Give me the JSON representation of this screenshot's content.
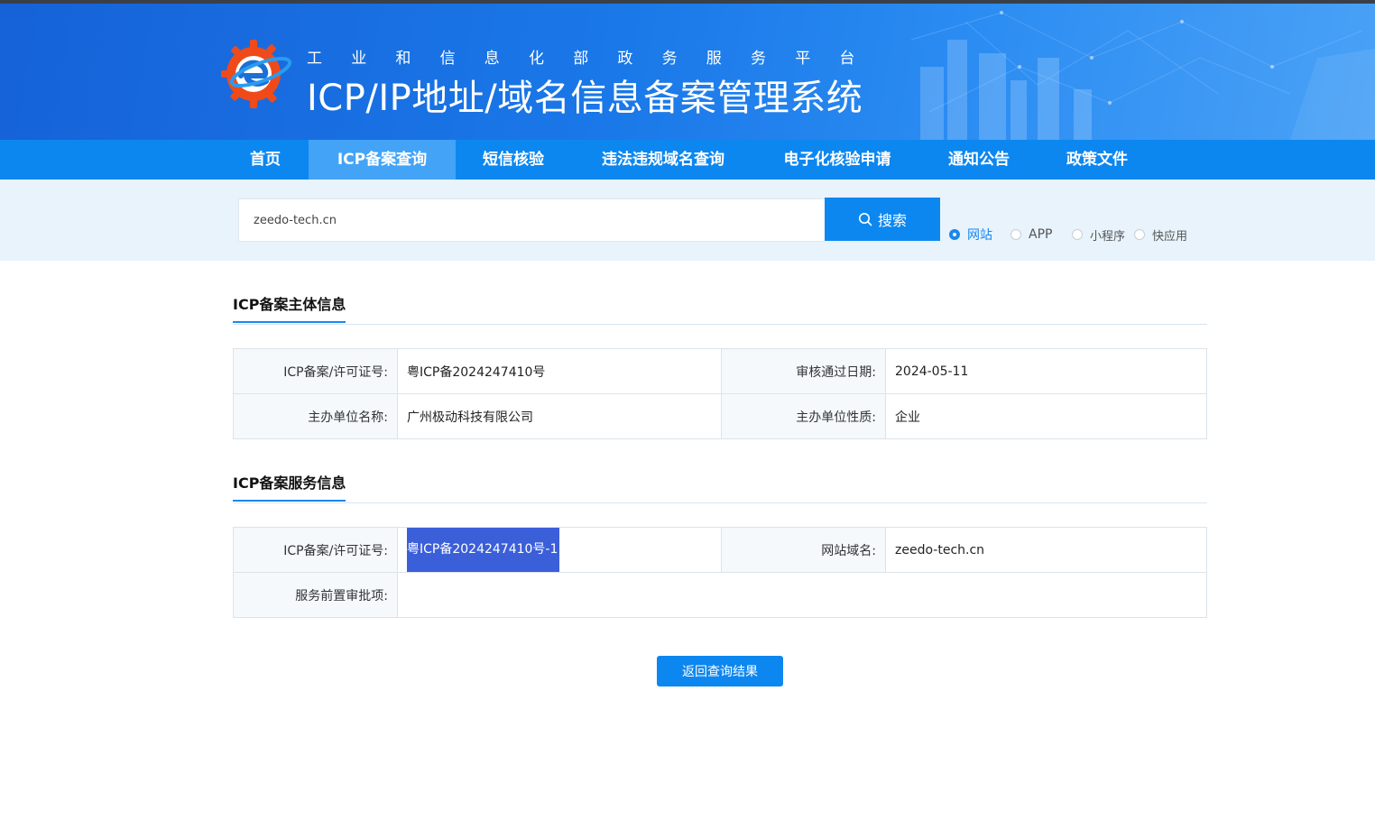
{
  "header": {
    "subtitle": "工业和信息化部政务服务平台",
    "title": "ICP/IP地址/域名信息备案管理系统"
  },
  "nav": {
    "items": [
      {
        "label": "首页"
      },
      {
        "label": "ICP备案查询"
      },
      {
        "label": "短信核验"
      },
      {
        "label": "违法违规域名查询"
      },
      {
        "label": "电子化核验申请"
      },
      {
        "label": "通知公告"
      },
      {
        "label": "政策文件"
      }
    ],
    "active": "ICP备案查询"
  },
  "search": {
    "value": "zeedo-tech.cn",
    "button_label": "搜索",
    "options": [
      {
        "label": "网站",
        "checked": true
      },
      {
        "label": "APP",
        "checked": false
      },
      {
        "label": "小程序",
        "checked": false
      },
      {
        "label": "快应用",
        "checked": false
      }
    ]
  },
  "subject": {
    "section_title": "ICP备案主体信息",
    "license_label": "ICP备案/许可证号:",
    "license_value": "粤ICP备2024247410号",
    "approval_date_label": "审核通过日期:",
    "approval_date_value": "2024-05-11",
    "org_name_label": "主办单位名称:",
    "org_name_value": "广州极动科技有限公司",
    "org_type_label": "主办单位性质:",
    "org_type_value": "企业"
  },
  "service": {
    "section_title": "ICP备案服务信息",
    "license_label": "ICP备案/许可证号:",
    "license_value": "粤ICP备2024247410号-1",
    "domain_label": "网站域名:",
    "domain_value": "zeedo-tech.cn",
    "preapproval_label": "服务前置审批项:",
    "preapproval_value": ""
  },
  "actions": {
    "back_label": "返回查询结果"
  },
  "colors": {
    "primary": "#0d87f0",
    "nav_active": "#43a3f6",
    "selection": "#3b5fd9"
  }
}
